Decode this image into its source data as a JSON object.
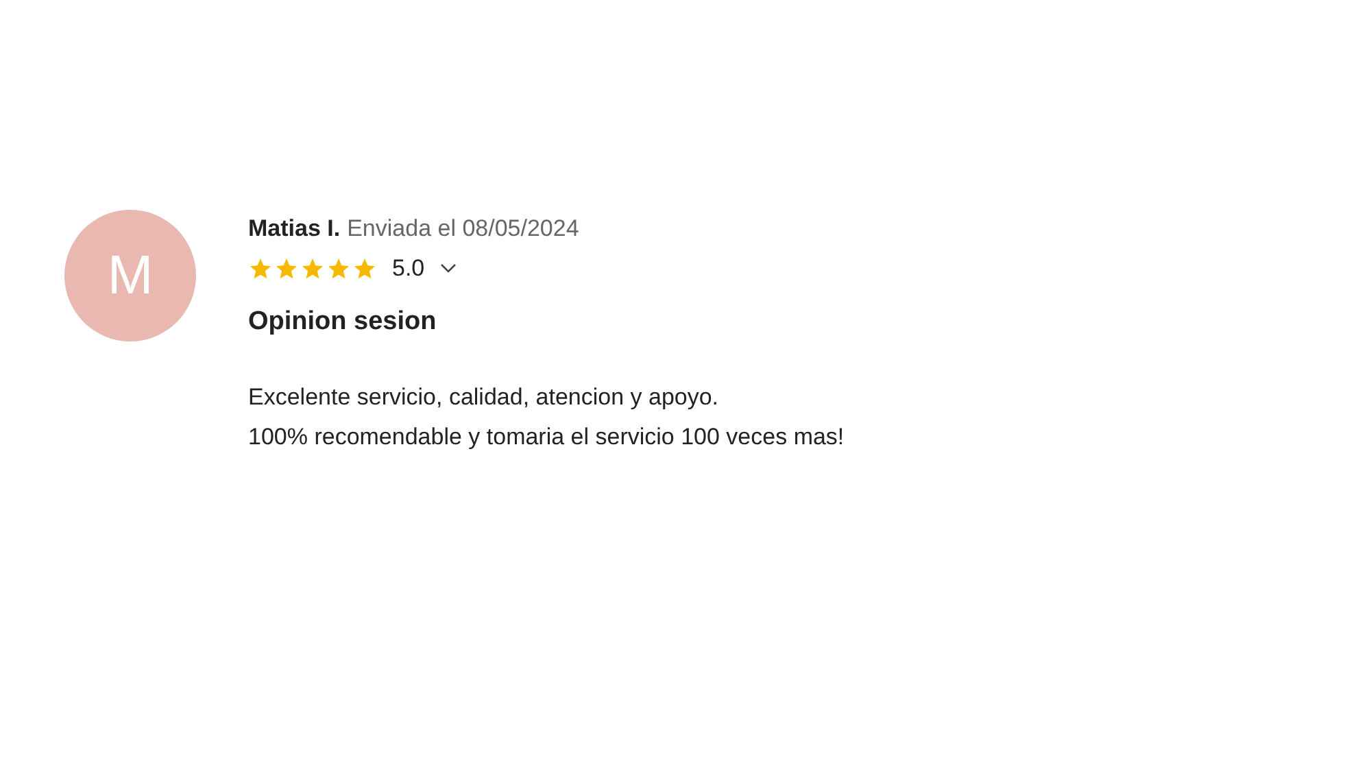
{
  "review": {
    "avatar_initial": "M",
    "author": "Matias I.",
    "sent": "Enviada el 08/05/2024",
    "stars": 5,
    "rating": "5.0",
    "title": "Opinion sesion",
    "body": [
      "Excelente servicio, calidad, atencion y apoyo.",
      "100% recomendable y tomaria el servicio 100 veces mas!"
    ]
  }
}
